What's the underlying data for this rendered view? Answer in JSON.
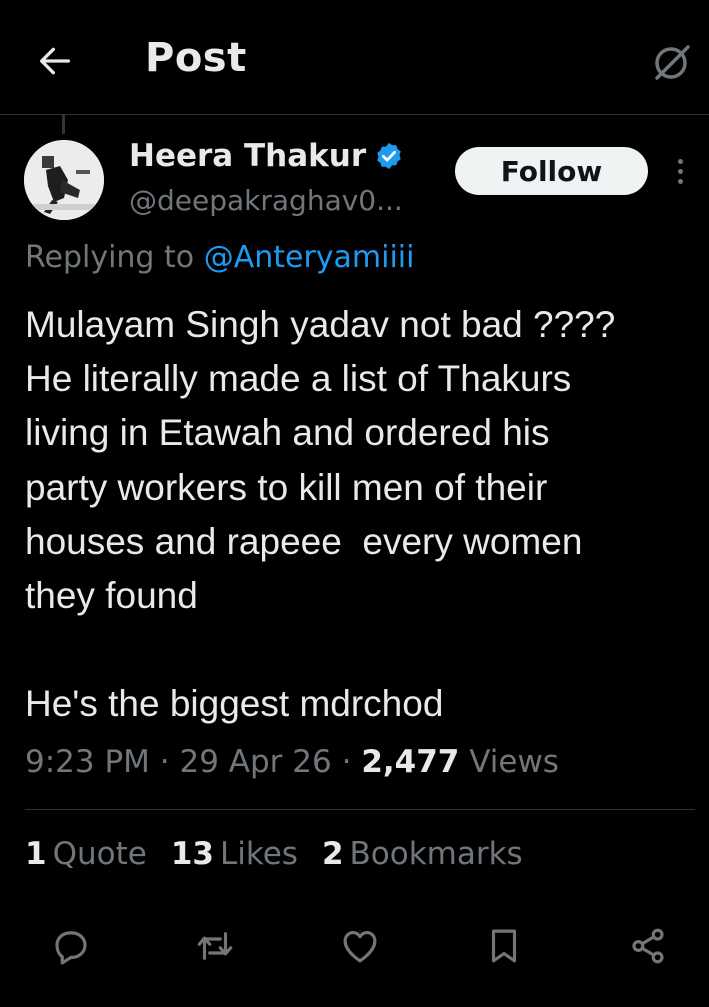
{
  "header": {
    "title": "Post",
    "back_icon": "arrow-left-icon",
    "grok_icon": "grok-icon"
  },
  "author": {
    "display_name": "Heera Thakur",
    "handle": "@deepakraghav0...",
    "verified_color": "#1d9bf0"
  },
  "follow_label": "Follow",
  "reply": {
    "prefix": "Replying to",
    "handle": "@Anteryamiiii"
  },
  "post_text": "Mulayam Singh yadav not bad ????\nHe literally made a list of Thakurs\nliving in Etawah and ordered his\nparty workers to kill men of their\nhouses and rapeee  every women\nthey found\n\nHe's the biggest mdrchod",
  "meta": {
    "time": "9:23 PM",
    "separator": "·",
    "date": "29 Apr 26",
    "views_count": "2,477",
    "views_label": "Views"
  },
  "stats": {
    "quotes_count": "1",
    "quotes_label": "Quote",
    "likes_count": "13",
    "likes_label": "Likes",
    "bookmarks_count": "2",
    "bookmarks_label": "Bookmarks"
  },
  "actions": [
    "reply-icon",
    "repost-icon",
    "like-icon",
    "bookmark-icon",
    "share-icon"
  ],
  "colors": {
    "background": "#000000",
    "text": "#e7e9ea",
    "muted": "#71767b",
    "accent": "#1d9bf0"
  }
}
